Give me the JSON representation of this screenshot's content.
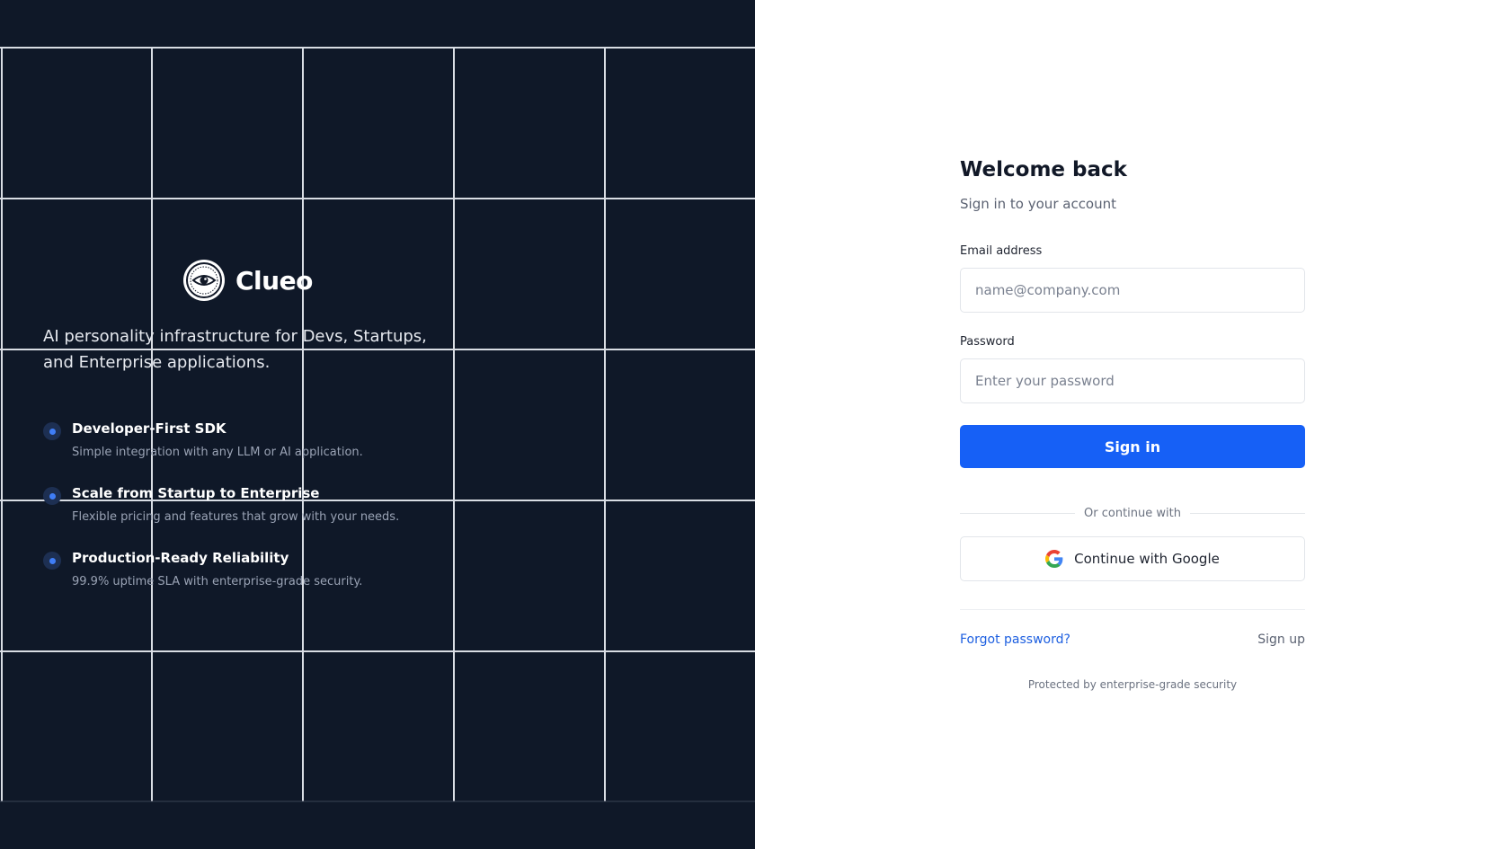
{
  "hero": {
    "brand_name": "Clueo",
    "tagline": "AI personality infrastructure for Devs, Startups, and Enterprise applications.",
    "features": [
      {
        "title": "Developer-First SDK",
        "description": "Simple integration with any LLM or AI application."
      },
      {
        "title": "Scale from Startup to Enterprise",
        "description": "Flexible pricing and features that grow with your needs."
      },
      {
        "title": "Production-Ready Reliability",
        "description": "99.9% uptime SLA with enterprise-grade security."
      }
    ],
    "logo_icon": "eye-icon",
    "bullet_icon": "dot-icon",
    "colors": {
      "background": "#0f1828",
      "grid_line": "#d9dde4",
      "accent": "#3f7df6"
    }
  },
  "login": {
    "title": "Welcome back",
    "subtitle": "Sign in to your account",
    "email": {
      "label": "Email address",
      "placeholder": "name@company.com",
      "value": ""
    },
    "password": {
      "label": "Password",
      "placeholder": "Enter your password",
      "value": ""
    },
    "signin_label": "Sign in",
    "divider_text": "Or continue with",
    "google_label": "Continue with Google",
    "google_icon": "google-icon",
    "forgot_label": "Forgot password?",
    "signup_label": "Sign up",
    "footnote": "Protected by enterprise-grade security",
    "colors": {
      "primary": "#1660f6",
      "link": "#1d5fe0"
    }
  }
}
